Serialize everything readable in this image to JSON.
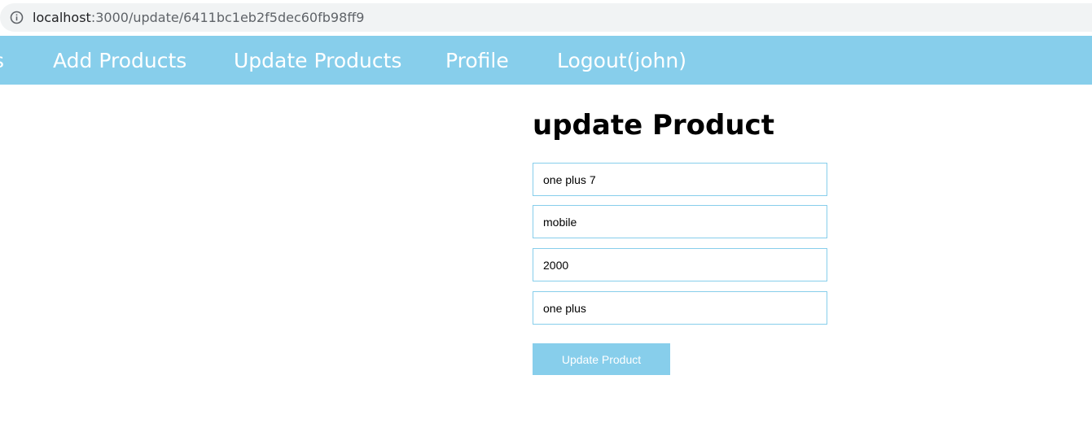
{
  "browser": {
    "url_host": "localhost",
    "url_path": ":3000/update/6411bc1eb2f5dec60fb98ff9"
  },
  "nav": {
    "items": [
      {
        "label": "s"
      },
      {
        "label": "Add Products"
      },
      {
        "label": "Update Products"
      },
      {
        "label": "Profile"
      },
      {
        "label": "Logout(john)"
      }
    ]
  },
  "form": {
    "title": "update Product",
    "fields": [
      {
        "value": "one plus 7"
      },
      {
        "value": "mobile"
      },
      {
        "value": "2000"
      },
      {
        "value": "one plus"
      }
    ],
    "submit_label": "Update Product"
  },
  "colors": {
    "nav_background": "#87ceeb",
    "input_border": "#87ceeb",
    "button_background": "#87ceeb",
    "address_bar_background": "#f1f3f4"
  },
  "icons": {
    "address_bar": "info-icon"
  }
}
